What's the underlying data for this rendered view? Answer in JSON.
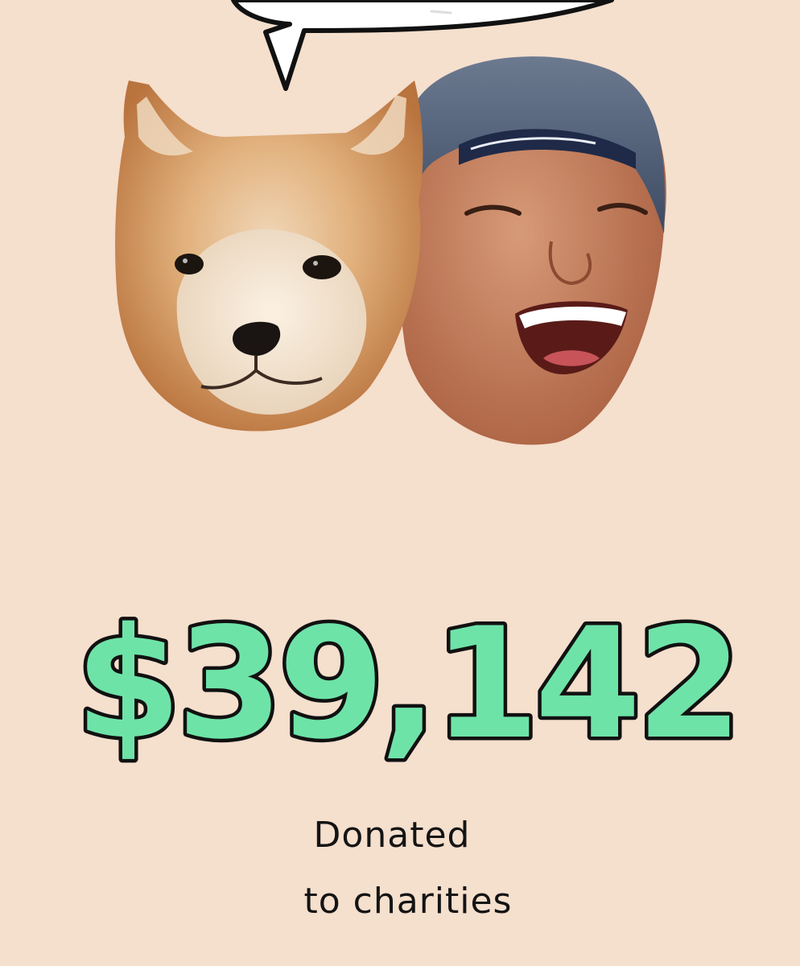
{
  "stat": {
    "amount": "$39,142",
    "caption_line1": "Donated",
    "caption_line2": "to charities"
  },
  "colors": {
    "background": "#f5dfcd",
    "amount_fill": "#6ee3a8",
    "amount_outline": "#111111",
    "text": "#141414"
  }
}
